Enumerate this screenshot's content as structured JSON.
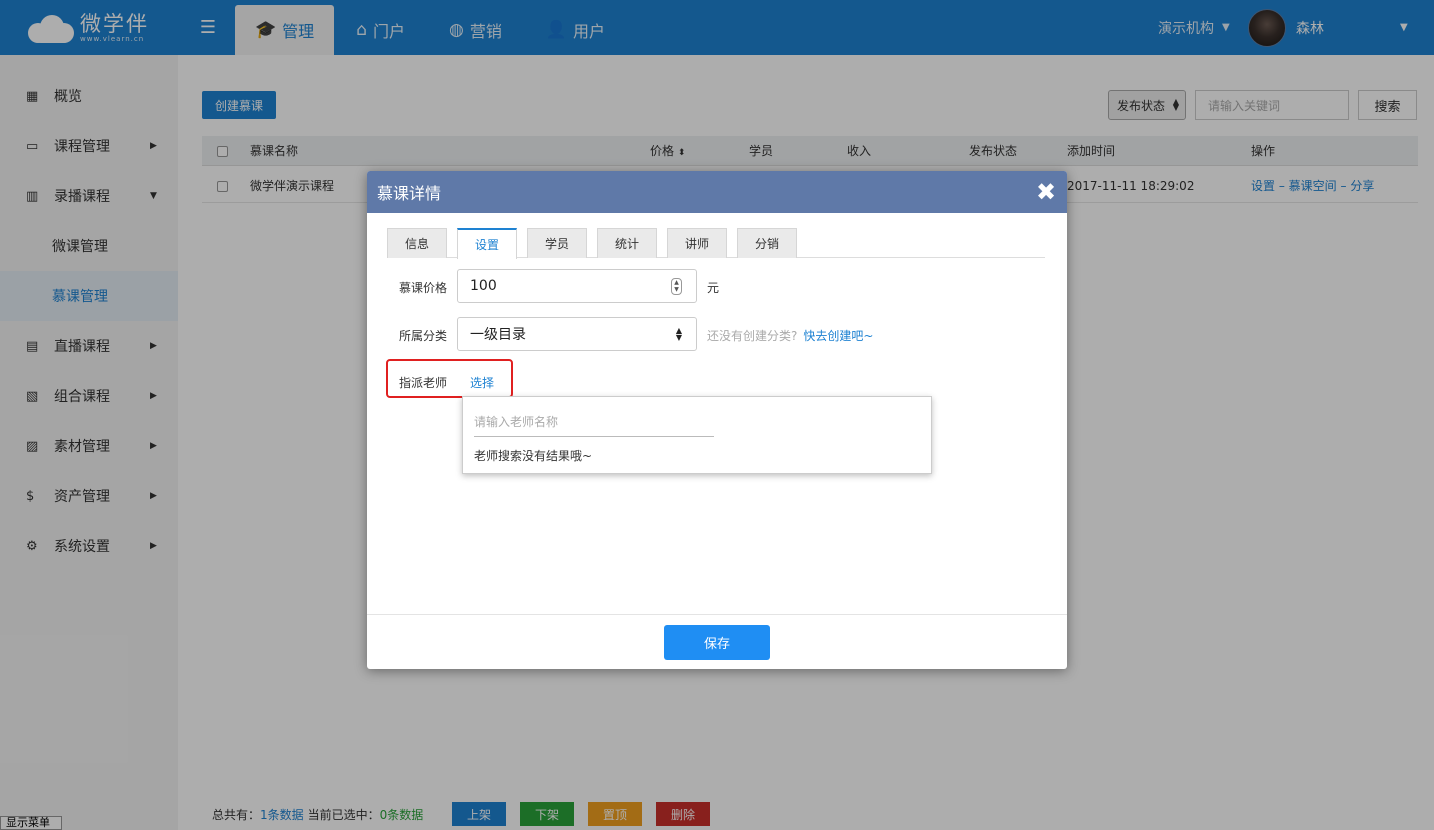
{
  "topbar": {
    "logo_cn": "微学伴",
    "logo_en": "www.vlearn.cn",
    "nav": [
      {
        "label": "管理",
        "icon": "graduation-cap-icon"
      },
      {
        "label": "门户",
        "icon": "home-icon"
      },
      {
        "label": "营销",
        "icon": "globe-icon"
      },
      {
        "label": "用户",
        "icon": "user-icon"
      }
    ],
    "org": "演示机构",
    "username": "森林"
  },
  "sidebar": {
    "items": [
      {
        "label": "概览",
        "icon": "grid-icon"
      },
      {
        "label": "课程管理",
        "icon": "book-icon"
      },
      {
        "label": "录播课程",
        "icon": "building-icon"
      },
      {
        "label": "微课管理"
      },
      {
        "label": "慕课管理"
      },
      {
        "label": "直播课程",
        "icon": "presentation-icon"
      },
      {
        "label": "组合课程",
        "icon": "bar-chart-icon"
      },
      {
        "label": "素材管理",
        "icon": "image-icon"
      },
      {
        "label": "资产管理",
        "icon": "dollar-icon"
      },
      {
        "label": "系统设置",
        "icon": "gear-icon"
      }
    ],
    "show_menu": "显示菜单"
  },
  "toolbar": {
    "create_label": "创建慕课",
    "status_select": "发布状态",
    "keyword_placeholder": "请输入关键词",
    "search_label": "搜索"
  },
  "table": {
    "headers": [
      "慕课名称",
      "价格",
      "学员",
      "收入",
      "发布状态",
      "添加时间",
      "操作"
    ],
    "rows": [
      {
        "name": "微学伴演示课程",
        "time": "2017-11-11 18:29:02",
        "actions": [
          "设置",
          "慕课空间",
          "分享"
        ],
        "sep": "–"
      }
    ]
  },
  "footer": {
    "total_label": "总共有：",
    "total_value": "1条数据",
    "selected_label": "当前已选中：",
    "selected_value": "0条数据",
    "buttons": [
      {
        "label": "上架",
        "color": "#1e82d2"
      },
      {
        "label": "下架",
        "color": "#2aa33a"
      },
      {
        "label": "置顶",
        "color": "#f0a020"
      },
      {
        "label": "删除",
        "color": "#c9302c"
      }
    ]
  },
  "modal": {
    "title": "慕课详情",
    "tabs": [
      "信息",
      "设置",
      "学员",
      "统计",
      "讲师",
      "分销"
    ],
    "active_tab": 1,
    "price_label": "慕课价格",
    "price_value": "100",
    "price_unit": "元",
    "category_label": "所属分类",
    "category_value": "一级目录",
    "category_hint": "还没有创建分类?",
    "category_link": "快去创建吧~",
    "teacher_label": "指派老师",
    "teacher_pick": "选择",
    "teacher_search_placeholder": "请输入老师名称",
    "teacher_empty": "老师搜索没有结果哦~",
    "save_label": "保存"
  }
}
